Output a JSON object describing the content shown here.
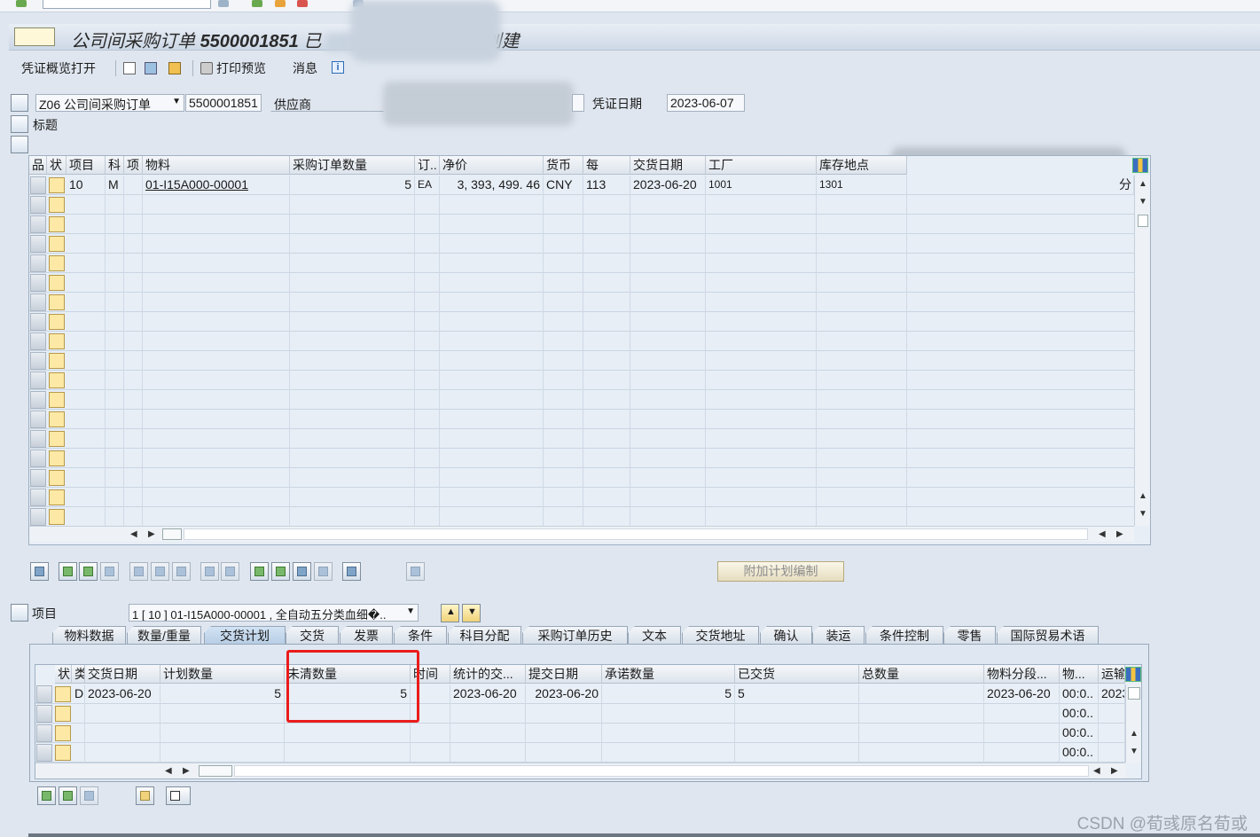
{
  "title": {
    "prefix": "公司间采购订单",
    "number": "5500001851",
    "tail_visible": "已",
    "suffix": "创建"
  },
  "toolbar": {
    "overview": "凭证概览打开",
    "print_preview": "打印预览",
    "messages": "消息"
  },
  "header": {
    "doc_type": "Z06 公司间采购订单",
    "po_number": "5500001851",
    "vendor_label": "供应商",
    "doc_date_label": "凭证日期",
    "doc_date": "2023-06-07",
    "section_label": "标题"
  },
  "items_table": {
    "columns": [
      "品",
      "状",
      "项目",
      "科",
      "项",
      "物料",
      "采购订单数量",
      "订..",
      "净价",
      "货币",
      "每",
      "交货日期",
      "工厂",
      "库存地点"
    ],
    "rows": [
      {
        "item": "10",
        "account_cat": "M",
        "material": "01-I15A000-00001",
        "qty": "5",
        "unit": "EA",
        "net_price": "3, 393, 499. 46",
        "currency": "CNY",
        "per": "113",
        "delivery_date": "2023-06-20",
        "plant": "1001",
        "storage_loc": "1301",
        "trailing": "分"
      }
    ]
  },
  "plan_button": "附加计划编制",
  "item_detail": {
    "label": "项目",
    "selector": "1 [ 10 ] 01-I15A000-00001 , 全自动五分类血细�.."
  },
  "tabs": [
    "物料数据",
    "数量/重量",
    "交货计划",
    "交货",
    "发票",
    "条件",
    "科目分配",
    "采购订单历史",
    "文本",
    "交货地址",
    "确认",
    "装运",
    "条件控制",
    "零售",
    "国际贸易术语"
  ],
  "active_tab": "交货计划",
  "schedule_table": {
    "columns": [
      "状",
      "类",
      "交货日期",
      "计划数量",
      "未清数量",
      "时间",
      "统计的交...",
      "提交日期",
      "承诺数量",
      "已交货",
      "总数量",
      "物料分段...",
      "物...",
      "运输"
    ],
    "rows": [
      {
        "cat": "D",
        "delivery_date": "2023-06-20",
        "sched_qty": "5",
        "open_qty": "5",
        "stat_date": "2023-06-20",
        "submit_date": "2023-06-20",
        "committed_qty": "5",
        "delivered": "5",
        "mat_seg_date": "2023-06-20",
        "time": "00:0..",
        "transport": "2023"
      },
      {
        "time": "00:0.."
      },
      {
        "time": "00:0.."
      },
      {
        "time": "00:0.."
      }
    ]
  },
  "watermark": "CSDN @荀彧原名荀或"
}
